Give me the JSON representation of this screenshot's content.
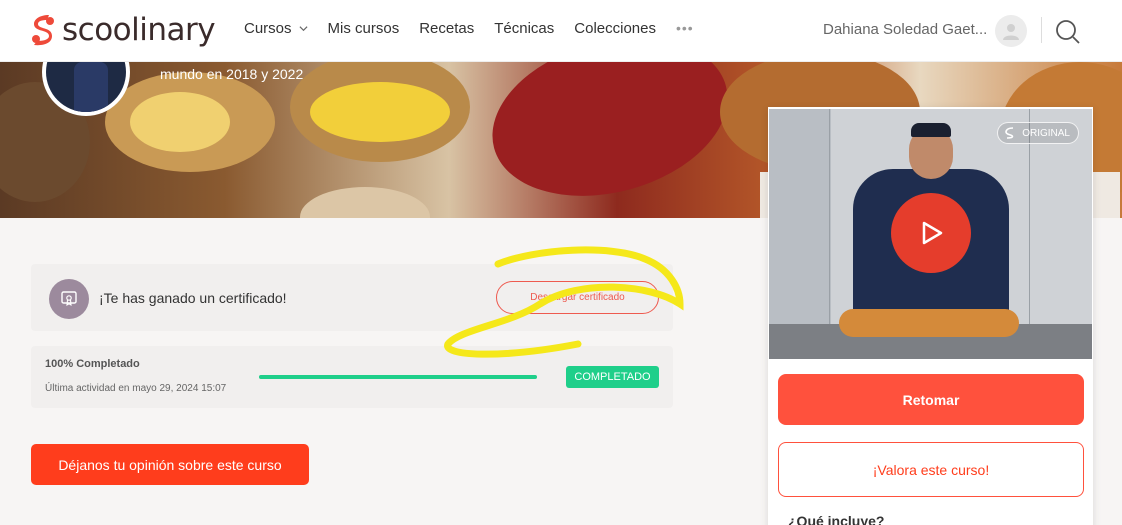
{
  "header": {
    "logo_text": "scoolinary",
    "nav": [
      {
        "label": "Cursos"
      },
      {
        "label": "Mis cursos"
      },
      {
        "label": "Recetas"
      },
      {
        "label": "Técnicas"
      },
      {
        "label": "Colecciones"
      }
    ],
    "more_label": "•••",
    "user_name": "Dahiana Soledad Gaet...",
    "brand_color": "#ee4a3a"
  },
  "hero": {
    "subtitle": "mundo en 2018 y 2022"
  },
  "certificate": {
    "message": "¡Te has ganado un certificado!",
    "download_label": "Descargar certificado"
  },
  "progress": {
    "percent_label": "100% Completado",
    "last_activity": "Última actividad en mayo 29, 2024 15:07",
    "percent": 100,
    "status_badge": "COMPLETADO"
  },
  "feedback": {
    "button_label": "Déjanos tu opinión sobre este curso"
  },
  "side_panel": {
    "badge_label": "ORIGINAL",
    "resume_label": "Retomar",
    "rate_label": "¡Valora este curso!",
    "includes_heading": "¿Qué incluye?"
  }
}
